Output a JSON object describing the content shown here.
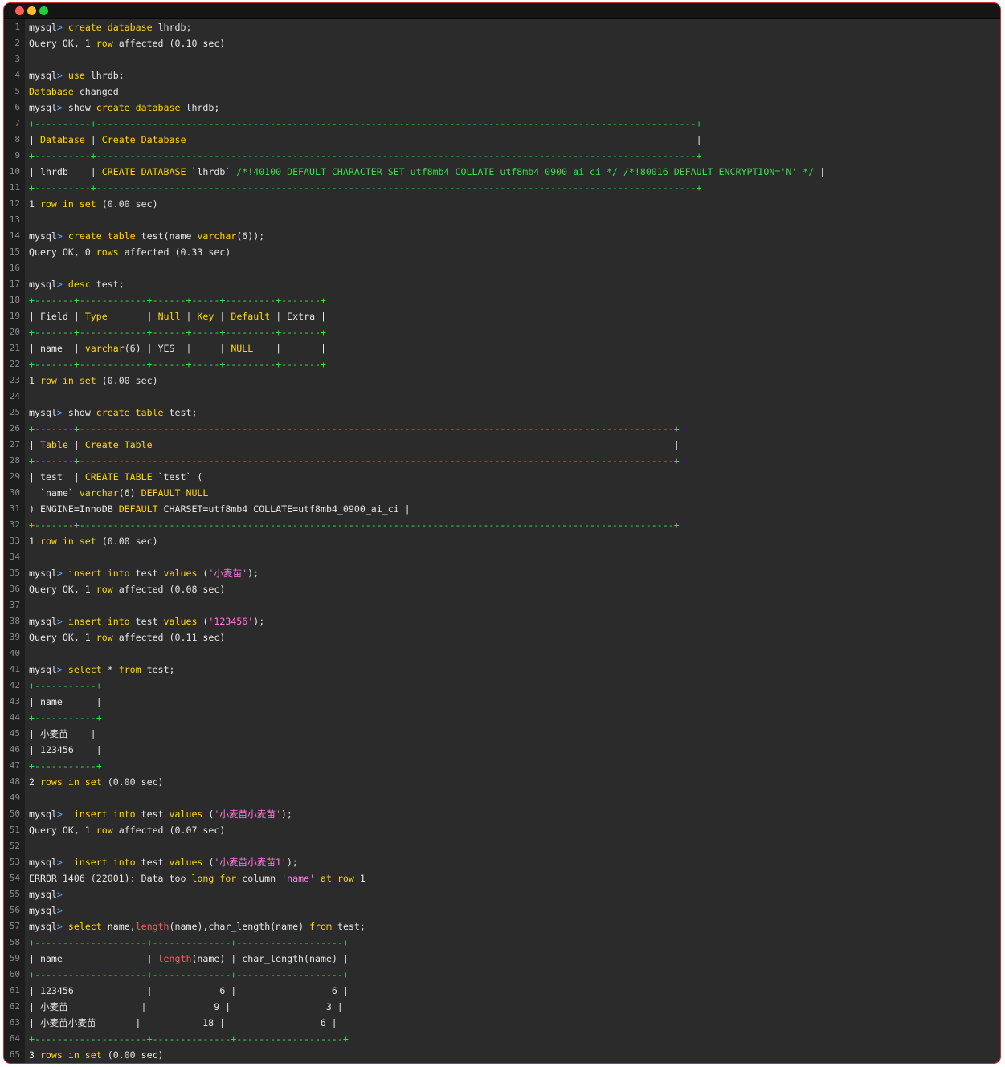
{
  "window": {
    "buttons": [
      {
        "name": "close-button",
        "color": "#ff5f56"
      },
      {
        "name": "minimize-button",
        "color": "#ffbd2e"
      },
      {
        "name": "maximize-button",
        "color": "#27c93f"
      }
    ]
  },
  "terminal": {
    "prompt": "mysql",
    "lines": [
      [
        [
          "mysql",
          ""
        ],
        [
          "> ",
          "p"
        ],
        [
          "create database ",
          "k"
        ],
        [
          "lhrdb;",
          ""
        ]
      ],
      [
        [
          "Query OK, 1 ",
          ""
        ],
        [
          "row",
          "k"
        ],
        [
          " affected (0.10 sec)",
          ""
        ]
      ],
      [],
      [
        [
          "mysql",
          ""
        ],
        [
          "> ",
          "p"
        ],
        [
          "use ",
          "k"
        ],
        [
          "lhrdb;",
          ""
        ]
      ],
      [
        [
          "Database",
          "k"
        ],
        [
          " changed",
          ""
        ]
      ],
      [
        [
          "mysql",
          ""
        ],
        [
          "> ",
          "p"
        ],
        [
          "show ",
          ""
        ],
        [
          "create database ",
          "k"
        ],
        [
          "lhrdb;",
          ""
        ]
      ],
      [
        [
          "+----------+-----------------------------------------------------------------------------------------------------------+",
          "g"
        ]
      ],
      [
        [
          "| ",
          ""
        ],
        [
          "Database",
          "k"
        ],
        [
          " | ",
          ""
        ],
        [
          "Create Database",
          "k"
        ],
        [
          "                                                                                           |",
          ""
        ]
      ],
      [
        [
          "+----------+-----------------------------------------------------------------------------------------------------------+",
          "g"
        ]
      ],
      [
        [
          "| lhrdb    | ",
          ""
        ],
        [
          "CREATE DATABASE ",
          "k"
        ],
        [
          "`lhrdb` ",
          ""
        ],
        [
          "/*!40100 DEFAULT CHARACTER SET utf8mb4 COLLATE utf8mb4_0900_ai_ci */ /*!80016 DEFAULT ENCRYPTION='N' */",
          "g"
        ],
        [
          " |",
          ""
        ]
      ],
      [
        [
          "+----------+-----------------------------------------------------------------------------------------------------------+",
          "g"
        ]
      ],
      [
        [
          "1 ",
          ""
        ],
        [
          "row in set",
          "k"
        ],
        [
          " (0.00 sec)",
          ""
        ]
      ],
      [],
      [
        [
          "mysql",
          ""
        ],
        [
          "> ",
          "p"
        ],
        [
          "create table ",
          "k"
        ],
        [
          "test(name ",
          ""
        ],
        [
          "varchar",
          "k"
        ],
        [
          "(6));",
          ""
        ]
      ],
      [
        [
          "Query OK, 0 ",
          ""
        ],
        [
          "rows",
          "k"
        ],
        [
          " affected (0.33 sec)",
          ""
        ]
      ],
      [],
      [
        [
          "mysql",
          ""
        ],
        [
          "> ",
          "p"
        ],
        [
          "desc ",
          "k"
        ],
        [
          "test;",
          ""
        ]
      ],
      [
        [
          "+-------+------------+------+-----+---------+-------+",
          "g"
        ]
      ],
      [
        [
          "| Field | ",
          ""
        ],
        [
          "Type",
          "k"
        ],
        [
          "       | ",
          ""
        ],
        [
          "Null",
          "k"
        ],
        [
          " | ",
          ""
        ],
        [
          "Key",
          "k"
        ],
        [
          " | ",
          ""
        ],
        [
          "Default",
          "k"
        ],
        [
          " | Extra |",
          ""
        ]
      ],
      [
        [
          "+-------+------------+------+-----+---------+-------+",
          "g"
        ]
      ],
      [
        [
          "| name  | ",
          ""
        ],
        [
          "varchar",
          "k"
        ],
        [
          "(6) | YES  |     | ",
          ""
        ],
        [
          "NULL",
          "k"
        ],
        [
          "    |       |",
          ""
        ]
      ],
      [
        [
          "+-------+------------+------+-----+---------+-------+",
          "g"
        ]
      ],
      [
        [
          "1 ",
          ""
        ],
        [
          "row in set",
          "k"
        ],
        [
          " (0.00 sec)",
          ""
        ]
      ],
      [],
      [
        [
          "mysql",
          ""
        ],
        [
          "> ",
          "p"
        ],
        [
          "show ",
          ""
        ],
        [
          "create table ",
          "k"
        ],
        [
          "test;",
          ""
        ]
      ],
      [
        [
          "+-------+----------------------------------------------------------------------------------------------------------+",
          "g"
        ]
      ],
      [
        [
          "| ",
          ""
        ],
        [
          "Table",
          "k"
        ],
        [
          " | ",
          ""
        ],
        [
          "Create Table",
          "k"
        ],
        [
          "                                                                                             |",
          ""
        ]
      ],
      [
        [
          "+-------+----------------------------------------------------------------------------------------------------------+",
          "g"
        ]
      ],
      [
        [
          "| test  | ",
          ""
        ],
        [
          "CREATE TABLE ",
          "k"
        ],
        [
          "`test` (",
          ""
        ]
      ],
      [
        [
          "  `name` ",
          ""
        ],
        [
          "varchar",
          "k"
        ],
        [
          "(6) ",
          ""
        ],
        [
          "DEFAULT NULL",
          "k"
        ]
      ],
      [
        [
          ") ENGINE=InnoDB ",
          ""
        ],
        [
          "DEFAULT",
          "k"
        ],
        [
          " CHARSET=utf8mb4 COLLATE=utf8mb4_0900_ai_ci |",
          ""
        ]
      ],
      [
        [
          "+-------+----------------------------------------------------------------------------------------------------------+",
          "g"
        ]
      ],
      [
        [
          "1 ",
          ""
        ],
        [
          "row in set",
          "k"
        ],
        [
          " (0.00 sec)",
          ""
        ]
      ],
      [],
      [
        [
          "mysql",
          ""
        ],
        [
          "> ",
          "p"
        ],
        [
          "insert into ",
          "k"
        ],
        [
          "test ",
          ""
        ],
        [
          "values ",
          "k"
        ],
        [
          "(",
          ""
        ],
        [
          "'小麦苗'",
          "s"
        ],
        [
          ");",
          ""
        ]
      ],
      [
        [
          "Query OK, 1 ",
          ""
        ],
        [
          "row",
          "k"
        ],
        [
          " affected (0.08 sec)",
          ""
        ]
      ],
      [],
      [
        [
          "mysql",
          ""
        ],
        [
          "> ",
          "p"
        ],
        [
          "insert into ",
          "k"
        ],
        [
          "test ",
          ""
        ],
        [
          "values ",
          "k"
        ],
        [
          "(",
          ""
        ],
        [
          "'123456'",
          "s"
        ],
        [
          ");",
          ""
        ]
      ],
      [
        [
          "Query OK, 1 ",
          ""
        ],
        [
          "row",
          "k"
        ],
        [
          " affected (0.11 sec)",
          ""
        ]
      ],
      [],
      [
        [
          "mysql",
          ""
        ],
        [
          "> ",
          "p"
        ],
        [
          "select ",
          "k"
        ],
        [
          "* ",
          ""
        ],
        [
          "from ",
          "k"
        ],
        [
          "test;",
          ""
        ]
      ],
      [
        [
          "+-----------+",
          "g"
        ]
      ],
      [
        [
          "| name      |",
          ""
        ]
      ],
      [
        [
          "+-----------+",
          "g"
        ]
      ],
      [
        [
          "| 小麦苗    |",
          ""
        ]
      ],
      [
        [
          "| 123456    |",
          ""
        ]
      ],
      [
        [
          "+-----------+",
          "g"
        ]
      ],
      [
        [
          "2 ",
          ""
        ],
        [
          "rows in set",
          "k"
        ],
        [
          " (0.00 sec)",
          ""
        ]
      ],
      [],
      [
        [
          "mysql",
          ""
        ],
        [
          ">  ",
          "p"
        ],
        [
          "insert into ",
          "k"
        ],
        [
          "test ",
          ""
        ],
        [
          "values ",
          "k"
        ],
        [
          "(",
          ""
        ],
        [
          "'小麦苗小麦苗'",
          "s"
        ],
        [
          ");",
          ""
        ]
      ],
      [
        [
          "Query OK, 1 ",
          ""
        ],
        [
          "row",
          "k"
        ],
        [
          " affected (0.07 sec)",
          ""
        ]
      ],
      [],
      [
        [
          "mysql",
          ""
        ],
        [
          ">  ",
          "p"
        ],
        [
          "insert into ",
          "k"
        ],
        [
          "test ",
          ""
        ],
        [
          "values ",
          "k"
        ],
        [
          "(",
          ""
        ],
        [
          "'小麦苗小麦苗1'",
          "s"
        ],
        [
          ");",
          ""
        ]
      ],
      [
        [
          "ERROR 1406 (22001): Data too ",
          ""
        ],
        [
          "long for ",
          "k"
        ],
        [
          "column ",
          ""
        ],
        [
          "'name'",
          "s"
        ],
        [
          " ",
          ""
        ],
        [
          "at ",
          "k"
        ],
        [
          "row",
          "k"
        ],
        [
          " 1",
          ""
        ]
      ],
      [
        [
          "mysql",
          ""
        ],
        [
          ">",
          "p"
        ]
      ],
      [
        [
          "mysql",
          ""
        ],
        [
          ">",
          "p"
        ]
      ],
      [
        [
          "mysql",
          ""
        ],
        [
          "> ",
          "p"
        ],
        [
          "select ",
          "k"
        ],
        [
          "name,",
          ""
        ],
        [
          "length",
          "r"
        ],
        [
          "(name),char_length(name) ",
          ""
        ],
        [
          "from ",
          "k"
        ],
        [
          "test;",
          ""
        ]
      ],
      [
        [
          "+--------------------+--------------+-------------------+",
          "g"
        ]
      ],
      [
        [
          "| name               | ",
          ""
        ],
        [
          "length",
          "r"
        ],
        [
          "(name) | char_length(name) |",
          ""
        ]
      ],
      [
        [
          "+--------------------+--------------+-------------------+",
          "g"
        ]
      ],
      [
        [
          "| 123456             |            6 |                 6 |",
          ""
        ]
      ],
      [
        [
          "| 小麦苗             |            9 |                 3 |",
          ""
        ]
      ],
      [
        [
          "| 小麦苗小麦苗       |           18 |                 6 |",
          ""
        ]
      ],
      [
        [
          "+--------------------+--------------+-------------------+",
          "g"
        ]
      ],
      [
        [
          "3 ",
          ""
        ],
        [
          "rows in set",
          "k"
        ],
        [
          " (0.00 sec)",
          ""
        ]
      ]
    ]
  }
}
